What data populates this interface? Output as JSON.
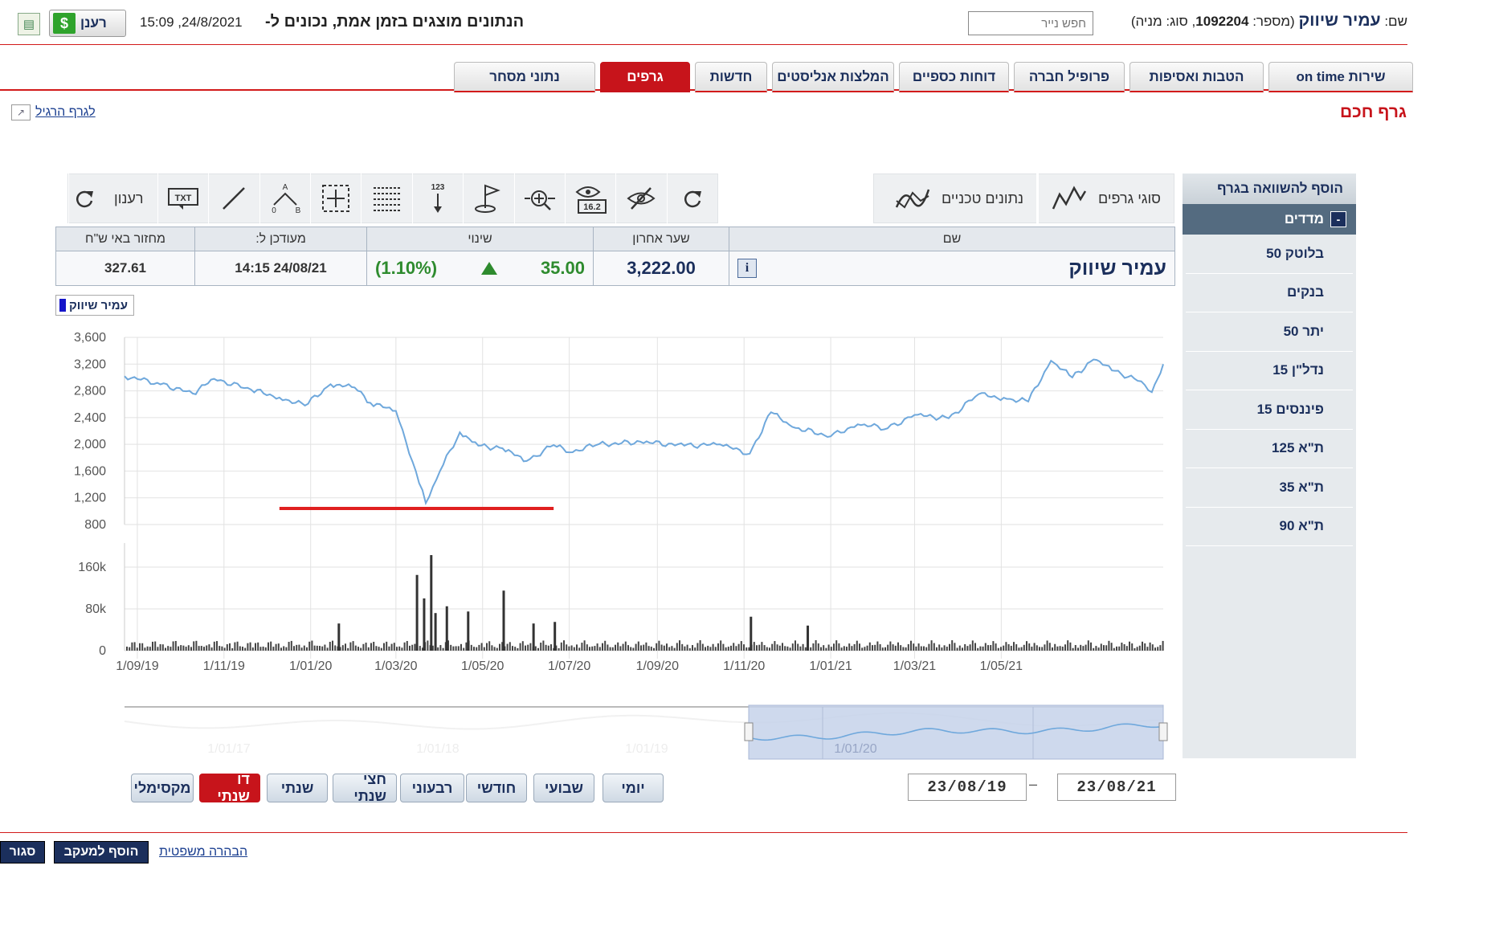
{
  "header": {
    "name_label": "שם:",
    "stock_name": "עמיר שיווק",
    "number_label": "(מספר:",
    "number": "1092204",
    "type_label": ", סוג: מניה)",
    "search_placeholder": "חפש נייר",
    "realtime_msg": "הנתונים מוצגים בזמן אמת, נכונים ל-",
    "datetime": "15:09 ,24/8/2021",
    "refresh_label": "רענן"
  },
  "tabs": [
    {
      "label": "נתוני מסחר",
      "active": false
    },
    {
      "label": "גרפים",
      "active": true
    },
    {
      "label": "חדשות",
      "active": false
    },
    {
      "label": "המלצות אנליסטים",
      "active": false
    },
    {
      "label": "דוחות כספיים",
      "active": false
    },
    {
      "label": "פרופיל חברה",
      "active": false
    },
    {
      "label": "הטבות ואסיפות",
      "active": false
    },
    {
      "label": "שירות on time",
      "active": false
    }
  ],
  "page": {
    "title": "גרף חכם",
    "regular_graph_link": "לגרף הרגיל"
  },
  "sidebar": {
    "header": "הוסף להשוואה בגרף",
    "group": "מדדים",
    "items": [
      "בלוטק 50",
      "בנקים",
      "יתר 50",
      "נדל\"ן 15",
      "פיננסים 15",
      "ת\"א 125",
      "ת\"א 35",
      "ת\"א 90"
    ]
  },
  "toolbar": {
    "chart_types": "סוגי גרפים",
    "technical": "נתונים טכניים",
    "refresh": "רענון",
    "icons": [
      "refresh-icon",
      "hide-icon",
      "eye-value-icon",
      "zoom-cross-icon",
      "flag-icon",
      "number-arrow-icon",
      "grid-lines-icon",
      "select-box-icon",
      "abc-pattern-icon",
      "line-draw-icon",
      "text-icon",
      "refresh-icon"
    ]
  },
  "quote": {
    "col_name": "שם",
    "col_last": "שער אחרון",
    "col_change": "שינוי",
    "col_updated": "מעודכן ל:",
    "col_turnover": "מחזור באי ש\"ח",
    "name": "עמיר שיווק",
    "last": "3,222.00",
    "change": "35.00",
    "change_pct": "(1.10%)",
    "updated": "24/08/21 14:15",
    "turnover": "327.61"
  },
  "colors": {
    "accent": "#c7141b",
    "navy": "#1b2f5c",
    "series": "#6fa8dc",
    "legend_swatch": "#1515c9",
    "up": "#2e8b2e"
  },
  "dates": {
    "from": "23/08/19",
    "to": "23/08/21"
  },
  "ranges": [
    {
      "label": "יומי",
      "active": false
    },
    {
      "label": "שבועי",
      "active": false
    },
    {
      "label": "חודשי",
      "active": false
    },
    {
      "label": "רבעוני",
      "active": false
    },
    {
      "label": "חצי שנתי",
      "active": false
    },
    {
      "label": "שנתי",
      "active": false
    },
    {
      "label": "דו שנתי",
      "active": true
    },
    {
      "label": "מקסימלי",
      "active": false
    }
  ],
  "footer": {
    "close": "סגור",
    "track": "הוסף למעקב",
    "legal": "הבהרה משפטית"
  },
  "chart_data": [
    {
      "type": "line",
      "legend": [
        "עמיר שיווק"
      ],
      "ylim": [
        800,
        3600
      ],
      "yticks": [
        "3,600",
        "3,200",
        "2,800",
        "2,400",
        "2,000",
        "1,600",
        "1,200",
        "800"
      ],
      "xticks": [
        "1/09/19",
        "1/11/19",
        "1/01/20",
        "1/03/20",
        "1/05/20",
        "1/07/20",
        "1/09/20",
        "1/11/20",
        "1/01/21",
        "1/03/21",
        "1/05/21"
      ],
      "series": [
        {
          "name": "עמיר שיווק",
          "x": [
            "2019-08-23",
            "2019-09-15",
            "2019-10-10",
            "2019-10-25",
            "2019-11-20",
            "2019-12-10",
            "2019-12-28",
            "2020-01-15",
            "2020-02-01",
            "2020-02-12",
            "2020-03-01",
            "2020-03-15",
            "2020-03-22",
            "2020-04-01",
            "2020-04-15",
            "2020-04-28",
            "2020-05-15",
            "2020-06-01",
            "2020-06-20",
            "2020-07-01",
            "2020-07-20",
            "2020-08-20",
            "2020-09-20",
            "2020-10-15",
            "2020-11-05",
            "2020-11-20",
            "2020-12-05",
            "2021-01-01",
            "2021-01-20",
            "2021-02-10",
            "2021-03-01",
            "2021-03-25",
            "2021-04-15",
            "2021-05-05",
            "2021-05-20",
            "2021-06-05",
            "2021-06-20",
            "2021-07-05",
            "2021-07-20",
            "2021-08-05",
            "2021-08-15",
            "2021-08-23"
          ],
          "values": [
            3020,
            2920,
            2760,
            2980,
            2820,
            2700,
            2580,
            2900,
            2850,
            2620,
            2500,
            1600,
            1120,
            1600,
            2180,
            1980,
            1940,
            1750,
            1990,
            1880,
            1990,
            2040,
            1980,
            2000,
            1860,
            2480,
            2260,
            2120,
            2300,
            2240,
            2440,
            2390,
            2750,
            2680,
            2640,
            3250,
            3000,
            3270,
            3100,
            2950,
            2780,
            3200
          ]
        }
      ]
    },
    {
      "type": "bar",
      "title": "",
      "ylim": [
        0,
        160000
      ],
      "yticks": [
        "160k",
        "80k",
        "0"
      ],
      "spikes": [
        {
          "x": "2020-01-20",
          "value": 52000
        },
        {
          "x": "2020-03-15",
          "value": 145000
        },
        {
          "x": "2020-03-20",
          "value": 100000
        },
        {
          "x": "2020-03-25",
          "value": 183000
        },
        {
          "x": "2020-03-28",
          "value": 72000
        },
        {
          "x": "2020-04-05",
          "value": 85000
        },
        {
          "x": "2020-04-20",
          "value": 75000
        },
        {
          "x": "2020-05-15",
          "value": 115000
        },
        {
          "x": "2020-06-05",
          "value": 52000
        },
        {
          "x": "2020-06-20",
          "value": 55000
        },
        {
          "x": "2020-11-05",
          "value": 65000
        },
        {
          "x": "2020-12-15",
          "value": 48000
        }
      ]
    }
  ],
  "navigator": {
    "labels": [
      "1/01/17",
      "1/01/18",
      "1/01/19",
      "1/01/20"
    ]
  }
}
